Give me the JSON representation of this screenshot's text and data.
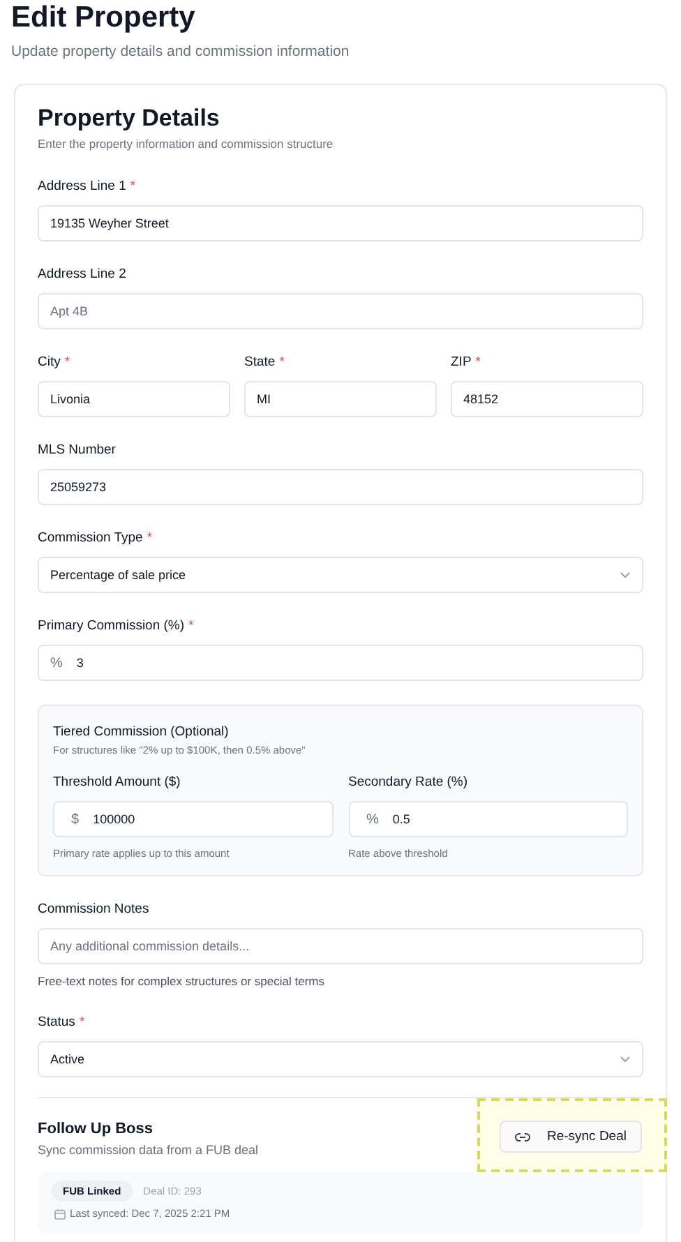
{
  "page": {
    "title": "Edit Property",
    "subtitle": "Update property details and commission information"
  },
  "card": {
    "title": "Property Details",
    "subtitle": "Enter the property information and commission structure"
  },
  "rows": [
    {
      "kind": "fields",
      "fields": [
        {
          "kind": "input",
          "label": "Address Line 1",
          "required_mark": "*",
          "value": "19135 Weyher Street"
        }
      ]
    },
    {
      "kind": "fields",
      "fields": [
        {
          "kind": "input",
          "label": "Address Line 2",
          "placeholder": "Apt 4B"
        }
      ]
    },
    {
      "kind": "fields",
      "fields": [
        {
          "kind": "input",
          "label": "City",
          "required_mark": "*",
          "value": "Livonia"
        },
        {
          "kind": "input",
          "label": "State",
          "required_mark": "*",
          "value": "MI"
        },
        {
          "kind": "input",
          "label": "ZIP",
          "required_mark": "*",
          "value": "48152"
        }
      ]
    },
    {
      "kind": "fields",
      "fields": [
        {
          "kind": "input",
          "label": "MLS Number",
          "value": "25059273"
        }
      ]
    },
    {
      "kind": "fields",
      "fields": [
        {
          "kind": "select",
          "label": "Commission Type",
          "required_mark": "*",
          "value": "Percentage of sale price"
        }
      ]
    },
    {
      "kind": "fields",
      "fields": [
        {
          "kind": "input",
          "label": "Primary Commission (%)",
          "required_mark": "*",
          "prefix": "%",
          "value": "3"
        }
      ]
    },
    {
      "kind": "panel",
      "title": "Tiered Commission (Optional)",
      "subtitle": "For structures like \"2% up to $100K, then 0.5% above\"",
      "fields": [
        {
          "kind": "input",
          "label": "Threshold Amount ($)",
          "prefix": "$",
          "value": "100000",
          "help": "Primary rate applies up to this amount"
        },
        {
          "kind": "input",
          "label": "Secondary Rate (%)",
          "prefix": "%",
          "value": "0.5",
          "help": "Rate above threshold"
        }
      ]
    },
    {
      "kind": "fields",
      "fields": [
        {
          "kind": "input",
          "label": "Commission Notes",
          "placeholder": "Any additional commission details...",
          "help": "Free-text notes for complex structures or special terms"
        }
      ]
    },
    {
      "kind": "fields",
      "fields": [
        {
          "kind": "select",
          "label": "Status",
          "required_mark": "*",
          "value": "Active"
        }
      ]
    }
  ],
  "sync": {
    "title": "Follow Up Boss",
    "subtitle": "Sync commission data from a FUB deal",
    "button": "Re-sync Deal",
    "highlighted": true,
    "badge": "FUB Linked",
    "deal": "Deal ID: 293",
    "last_synced": "Last synced: Dec 7, 2025 2:21 PM"
  }
}
